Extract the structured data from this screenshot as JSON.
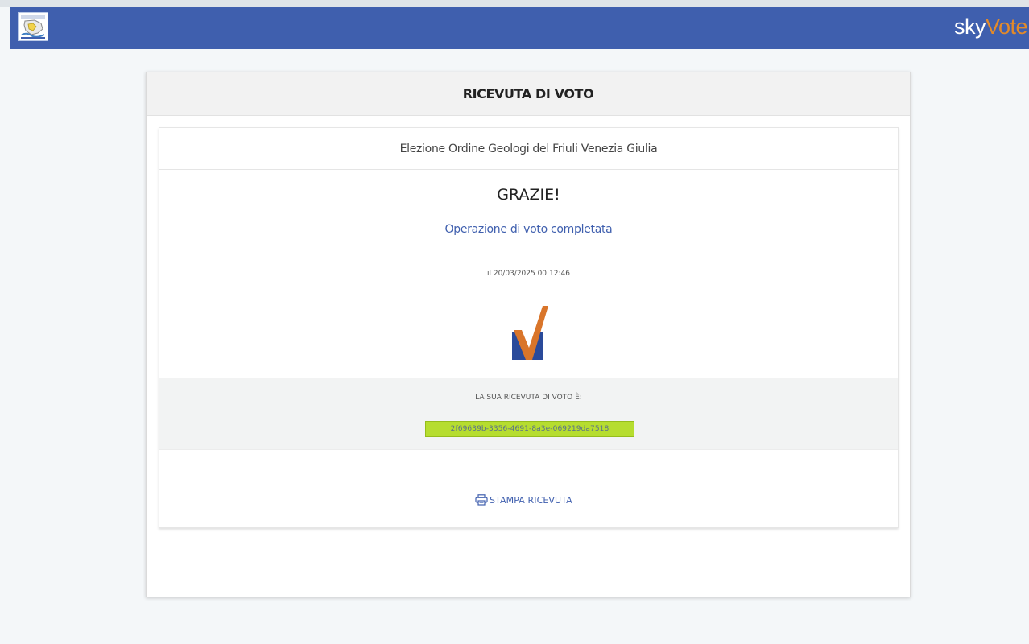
{
  "header": {
    "brand_prefix": "sky",
    "brand_accent": "Vote",
    "bar_color": "#3f5fae",
    "accent_color": "#e38a2a"
  },
  "receipt": {
    "title": "RICEVUTA DI VOTO",
    "election_name": "Elezione Ordine Geologi del Friuli Venezia Giulia",
    "thanks": "GRAZIE!",
    "status": "Operazione di voto completata",
    "timestamp": "il 20/03/2025 00:12:46",
    "code_label": "LA SUA RICEVUTA DI VOTO È:",
    "code_value": "2f69639b-3356-4691-8a3e-069219da7518",
    "code_highlight_color": "#b6dd2f",
    "print_label": "STAMPA RICEVUTA",
    "print_icon": "printer-icon",
    "mark_icon": "vote-check-icon"
  }
}
